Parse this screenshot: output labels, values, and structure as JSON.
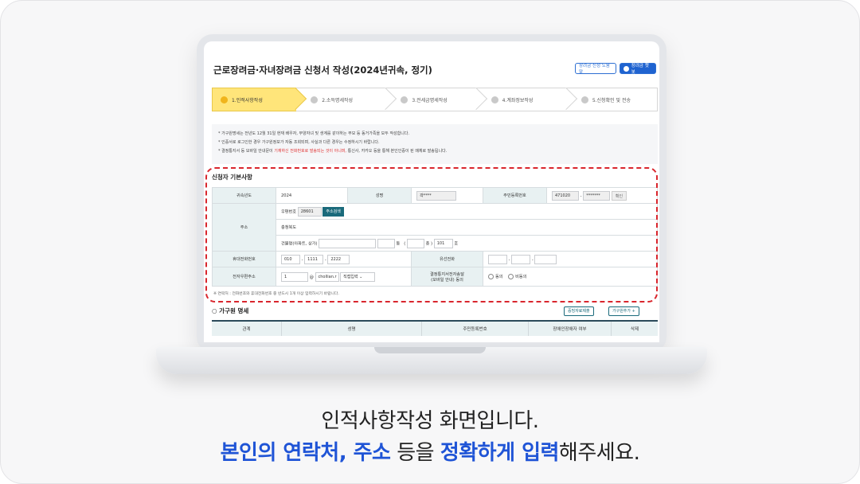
{
  "app": {
    "title": "근로장려금·자녀장려금 신청서 작성(2024년귀속, 정기)",
    "help_button": "장려금 신청 도움말",
    "chat_button": "장려금 챗봇"
  },
  "steps": [
    {
      "label": "1.인적사항작성",
      "active": true
    },
    {
      "label": "2.소득명세작성",
      "active": false
    },
    {
      "label": "3.전세금명세작성",
      "active": false
    },
    {
      "label": "4.계좌정보작성",
      "active": false
    },
    {
      "label": "5.신청확인 및 전송",
      "active": false
    }
  ],
  "notices": {
    "line1": "* 가구원명세는 전년도 12월 31일 현재 배우자, 부양자녀 및 생계를 같이하는 부모 등 동거가족을 모두 작성합니다.",
    "line2": "* 인증서로 로그인한 경우 가구원정보가 자동 조회되며, 사실과 다른 경우는 수정하시기 바랍니다.",
    "line3_pre": "* 결정통지서 등 모바일 안내문이 ",
    "line3_red": "기재하신 전화번호로 발송되는 것이 아니며,",
    "line3_post": " 통신사, 카카오 등을 통해 본인인증이 된 매체로 발송됩니다."
  },
  "applicant": {
    "section_title": "신청자 기본사항",
    "year_label": "귀속년도",
    "year_value": "2024",
    "name_label": "성명",
    "name_value": "곽****",
    "rrn_label": "주민등록번호",
    "rrn_front": "471020",
    "rrn_dash": "-",
    "rrn_back": "*******",
    "confirm_button": "확인",
    "address_label": "주소",
    "zip_label": "우편번호",
    "zip_value": "28601",
    "address_search_button": "주소검색",
    "address_line": "충청북도",
    "building_label": "건물명(아파트, 상가)",
    "dong_label": "동",
    "paren_open": "(",
    "floor_label": "층",
    "paren_close": ")",
    "ho_value": "101",
    "ho_label": "호",
    "mobile_label": "휴대전화번호",
    "mobile_1": "010",
    "mobile_2": "1111",
    "mobile_3": "2222",
    "landline_label": "유선전화",
    "email_label": "전자우편주소",
    "email_id": "1",
    "email_at": "@",
    "email_domain": "chollian.r",
    "email_select": "직접입력",
    "consent_label_1": "결정통지서전자송달",
    "consent_label_2": "(모바일 안내) 동의",
    "consent_yes": "동의",
    "consent_no": "비동의",
    "footnote": "※ 연락처 : 전화번호와 휴대전화번호 중 반드시 1개 이상 입력하시기 바랍니다."
  },
  "family": {
    "title": "가구원 명세",
    "proof_button": "증빙자료제출",
    "add_button": "가구원추가 +",
    "columns": [
      "관계",
      "성명",
      "주민등록번호",
      "장애인장애자 여부",
      "삭제"
    ]
  },
  "caption": {
    "line1": "인적사항작성 화면입니다.",
    "line2_hl1": "본인의 연락처, 주소",
    "line2_mid": " 등을 ",
    "line2_hl2": "정확하게 입력",
    "line2_end": "해주세요."
  },
  "colors": {
    "accent_blue": "#1f54d6",
    "dashed_red": "#d9262d",
    "active_step": "#ffe57a"
  }
}
